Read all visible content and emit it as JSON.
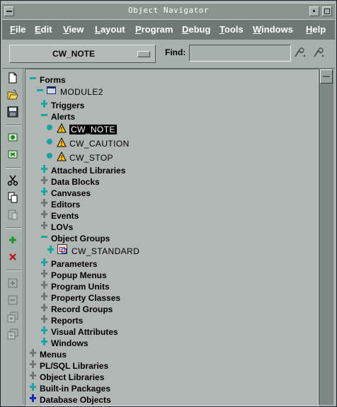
{
  "window": {
    "title": "Object Navigator"
  },
  "menu": [
    "File",
    "Edit",
    "View",
    "Layout",
    "Program",
    "Debug",
    "Tools",
    "Windows",
    "Help"
  ],
  "toolbar": {
    "context_value": "CW_NOTE",
    "find_label": "Find:",
    "find_value": ""
  },
  "side_toolbar": {
    "icons": [
      "new-icon",
      "open-icon",
      "save-icon",
      "run-form-icon",
      "debug-icon",
      "cut-icon",
      "copy-icon",
      "paste-icon",
      "create-icon",
      "delete-icon",
      "expand-icon",
      "collapse-icon",
      "expand-all-icon",
      "collapse-all-icon"
    ]
  },
  "tree": [
    {
      "label": "Forms"
    },
    {
      "label": "MODULE2"
    },
    {
      "label": "Triggers"
    },
    {
      "label": "Alerts"
    },
    {
      "label": "CW_NOTE",
      "selected": true
    },
    {
      "label": "CW_CAUTION"
    },
    {
      "label": "CW_STOP"
    },
    {
      "label": "Attached Libraries"
    },
    {
      "label": "Data Blocks"
    },
    {
      "label": "Canvases"
    },
    {
      "label": "Editors"
    },
    {
      "label": "Events"
    },
    {
      "label": "LOVs"
    },
    {
      "label": "Object Groups"
    },
    {
      "label": "CW_STANDARD"
    },
    {
      "label": "Parameters"
    },
    {
      "label": "Popup Menus"
    },
    {
      "label": "Program Units"
    },
    {
      "label": "Property Classes"
    },
    {
      "label": "Record Groups"
    },
    {
      "label": "Reports"
    },
    {
      "label": "Visual Attributes"
    },
    {
      "label": "Windows"
    },
    {
      "label": "Menus"
    },
    {
      "label": "PL/SQL Libraries"
    },
    {
      "label": "Object Libraries"
    },
    {
      "label": "Built-in Packages"
    },
    {
      "label": "Database Objects"
    }
  ],
  "colors": {
    "tree_background": "#b0b7b4",
    "expanded_node": "#16a7a2",
    "collapsed_node": "#6f7874",
    "database_node": "#1b28b5",
    "selection": "#000000"
  }
}
